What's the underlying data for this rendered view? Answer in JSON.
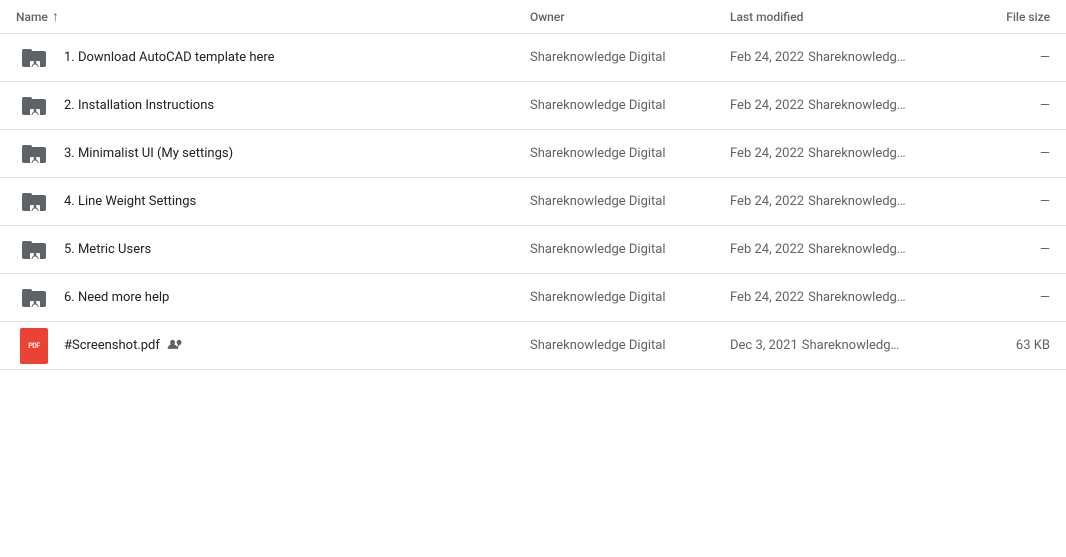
{
  "header": {
    "name_label": "Name",
    "owner_label": "Owner",
    "modified_label": "Last modified",
    "size_label": "File size"
  },
  "rows": [
    {
      "id": 1,
      "icon_type": "folder",
      "name": "1. Download AutoCAD template here",
      "owner": "Shareknowledge Digital",
      "modified_date": "Feb 24, 2022",
      "modified_user": "Shareknowledge …",
      "size": "—"
    },
    {
      "id": 2,
      "icon_type": "folder",
      "name": "2. Installation Instructions",
      "owner": "Shareknowledge Digital",
      "modified_date": "Feb 24, 2022",
      "modified_user": "Shareknowledge …",
      "size": "—"
    },
    {
      "id": 3,
      "icon_type": "folder",
      "name": "3. Minimalist UI (My settings)",
      "owner": "Shareknowledge Digital",
      "modified_date": "Feb 24, 2022",
      "modified_user": "Shareknowledge …",
      "size": "—"
    },
    {
      "id": 4,
      "icon_type": "folder",
      "name": "4. Line Weight Settings",
      "owner": "Shareknowledge Digital",
      "modified_date": "Feb 24, 2022",
      "modified_user": "Shareknowledge …",
      "size": "—"
    },
    {
      "id": 5,
      "icon_type": "folder",
      "name": "5. Metric Users",
      "owner": "Shareknowledge Digital",
      "modified_date": "Feb 24, 2022",
      "modified_user": "Shareknowledge …",
      "size": "—"
    },
    {
      "id": 6,
      "icon_type": "folder",
      "name": "6. Need more help",
      "owner": "Shareknowledge Digital",
      "modified_date": "Feb 24, 2022",
      "modified_user": "Shareknowledge …",
      "size": "—"
    },
    {
      "id": 7,
      "icon_type": "pdf",
      "name": "#Screenshot.pdf",
      "has_shared": true,
      "owner": "Shareknowledge Digital",
      "modified_date": "Dec 3, 2021",
      "modified_user": "Shareknowledge …",
      "size": "63 KB"
    }
  ]
}
